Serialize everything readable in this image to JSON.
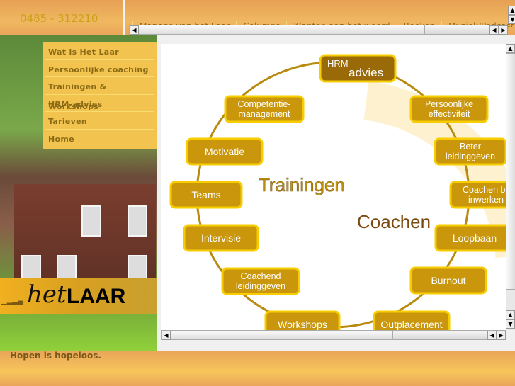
{
  "header": {
    "phone": "0485 - 312210",
    "top_nav": [
      "Manege van het Laar",
      "Columns",
      "Klanten aan het woord",
      "Boeken",
      "Muziek/Podcast"
    ]
  },
  "menu": {
    "items": [
      {
        "label": "Wat is Het Laar"
      },
      {
        "label": "Persoonlijke coaching"
      },
      {
        "label": "Trainingen & Workshops"
      },
      {
        "label": "HRM-advies"
      },
      {
        "label": "Tarieven"
      },
      {
        "label": "Home"
      }
    ]
  },
  "logo": {
    "het": "het",
    "laar": "LAAR"
  },
  "footer": {
    "quote": "Hopen is hopeloos."
  },
  "diagram": {
    "center_labels": {
      "trainingen": "Trainingen",
      "coachen": "Coachen"
    },
    "hrm": {
      "small": "HRM",
      "large": "advies"
    },
    "nodes": [
      {
        "lines": [
          "Competentie-",
          "management"
        ]
      },
      {
        "lines": [
          "Persoonlijke",
          "effectiviteit"
        ]
      },
      {
        "lines": [
          "Motivatie"
        ]
      },
      {
        "lines": [
          "Beter",
          "leidinggeven"
        ]
      },
      {
        "lines": [
          "Teams"
        ]
      },
      {
        "lines": [
          "Coachen bij",
          "inwerken"
        ]
      },
      {
        "lines": [
          "Intervisie"
        ]
      },
      {
        "lines": [
          "Loopbaan"
        ]
      },
      {
        "lines": [
          "Coachend",
          "leidinggeven"
        ]
      },
      {
        "lines": [
          "Burnout"
        ]
      },
      {
        "lines": [
          "Workshops"
        ]
      },
      {
        "lines": [
          "Outplacement"
        ]
      }
    ],
    "colors": {
      "box_fill": "#c9960c",
      "box_stroke": "#f7cd00",
      "ring": "#b88a10",
      "hrm_fill": "#9a6a08"
    }
  }
}
